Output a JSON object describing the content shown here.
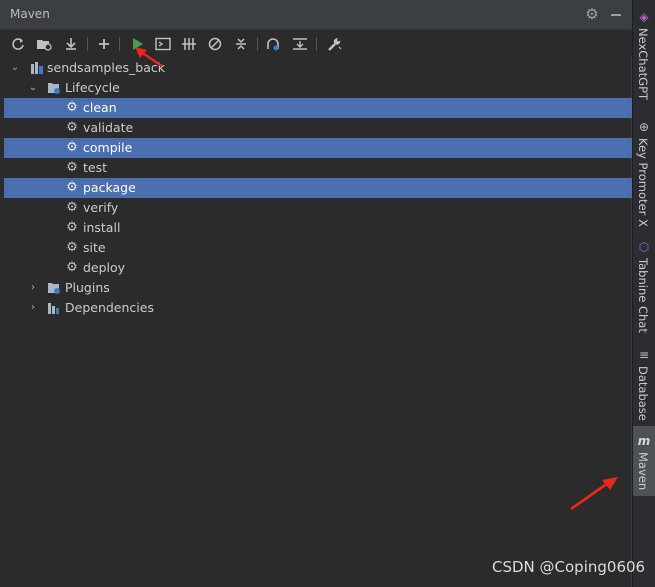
{
  "panel": {
    "title": "Maven",
    "project": "sendsamples_back",
    "lifecycle_label": "Lifecycle",
    "lifecycle_items": [
      "clean",
      "validate",
      "compile",
      "test",
      "package",
      "verify",
      "install",
      "site",
      "deploy"
    ],
    "plugins_label": "Plugins",
    "dependencies_label": "Dependencies"
  },
  "sidebar_tabs": [
    "NexChatGPT",
    "Key Promoter X",
    "Tabnine Chat",
    "Database",
    "Maven"
  ],
  "watermark": "CSDN @Coping0606",
  "colors": {
    "selection": "#4b6eaf",
    "run_green": "#499c54",
    "annotation_red": "#e8281b"
  }
}
